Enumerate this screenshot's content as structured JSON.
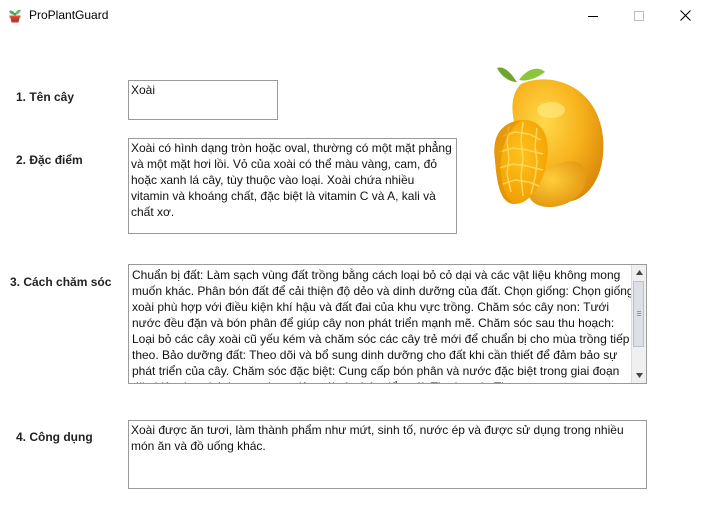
{
  "window": {
    "title": "ProPlantGuard",
    "icon": "plant-pot-icon",
    "controls": [
      "minimize-icon",
      "maximize-icon",
      "close-icon"
    ]
  },
  "form": {
    "name_label": "1. Tên cây",
    "name_value": "Xoài",
    "features_label": "2. Đặc điểm",
    "features_value": "Xoài có hình dạng tròn hoặc oval, thường có một mặt phẳng và một mặt hơi lồi. Vỏ của xoài có thể màu vàng, cam, đỏ hoặc xanh lá cây, tùy thuộc vào loại. Xoài chứa nhiều vitamin và khoáng chất, đặc biệt là vitamin C và A, kali và chất xơ.",
    "care_label": "3. Cách chăm sóc",
    "care_value": "Chuẩn bị đất: Làm sạch vùng đất trồng bằng cách loại bỏ cỏ dại và các vật liệu không mong muốn khác. Phân bón đất để cải thiện độ dẻo và dinh dưỡng của đất. Chọn giống: Chọn giống xoài phù hợp với điều kiện khí hậu và đất đai của khu vực trồng. Chăm sóc cây non: Tưới nước đều đặn và bón phân để giúp cây non phát triển mạnh mẽ. Chăm sóc sau thu hoạch: Loại bỏ các cây xoài cũ yếu kém và chăm sóc các cây trẻ mới để chuẩn bị cho mùa trồng tiếp theo. Bảo dưỡng đất: Theo dõi và bổ sung dinh dưỡng cho đất khi cần thiết để đảm bảo sự phát triển của cây. Chăm sóc đặc biệt: Cung cấp bón phân và nước đặc biệt trong giai đoạn đặc biệt như giai đoạn ra hoa, đậu trái và phát triển trái. Thu hoạch: Thu",
    "uses_label": "4. Công dụng",
    "uses_value": "Xoài được ăn tươi, làm thành phẩm như mứt, sinh tố, nước ép và được sử dụng trong nhiều món ăn và đồ uống khác."
  },
  "image": {
    "subject": "mango-image"
  }
}
